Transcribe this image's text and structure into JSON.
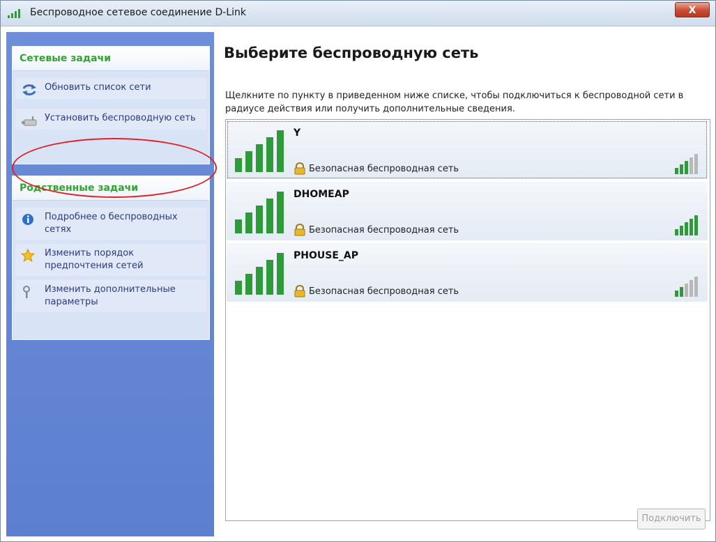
{
  "window": {
    "title": "Беспроводное сетевое соединение D-Link",
    "close_glyph": "X"
  },
  "sidebar": {
    "groups": [
      {
        "header": "Сетевые задачи",
        "tasks": [
          {
            "label": "Обновить список сети",
            "icon": "refresh-icon"
          },
          {
            "label": "Установить беспроводную сеть",
            "icon": "setup-network-icon"
          }
        ]
      },
      {
        "header": "Родственные задачи",
        "tasks": [
          {
            "label": "Подробнее о беспроводных сетях",
            "icon": "info-icon"
          },
          {
            "label": "Изменить порядок предпочтения  сетей",
            "icon": "star-icon"
          },
          {
            "label": "Изменить дополнительные параметры",
            "icon": "wrench-icon"
          }
        ]
      }
    ]
  },
  "main": {
    "heading": "Выберите беспроводную сеть",
    "instruction": "Щелкните по пункту в приведенном ниже списке, чтобы подключиться к беспроводной сети в радиусе действия или получить дополнительные сведения.",
    "networks": [
      {
        "ssid": "Y",
        "security": "Безопасная беспроводная сеть",
        "signal_bars": 3,
        "selected": true
      },
      {
        "ssid": "DHOMEAP",
        "security": "Безопасная беспроводная сеть",
        "signal_bars": 5,
        "selected": false
      },
      {
        "ssid": "PHOUSE_AP",
        "security": "Безопасная беспроводная сеть",
        "signal_bars": 2,
        "selected": false
      }
    ],
    "connect_label": "Подключить"
  },
  "colors": {
    "task_header": "#2fa62f",
    "task_link": "#2b3a7a",
    "signal_active": "#2e9a3a",
    "signal_inactive": "#b8b8b8",
    "annotation": "#e02020"
  }
}
